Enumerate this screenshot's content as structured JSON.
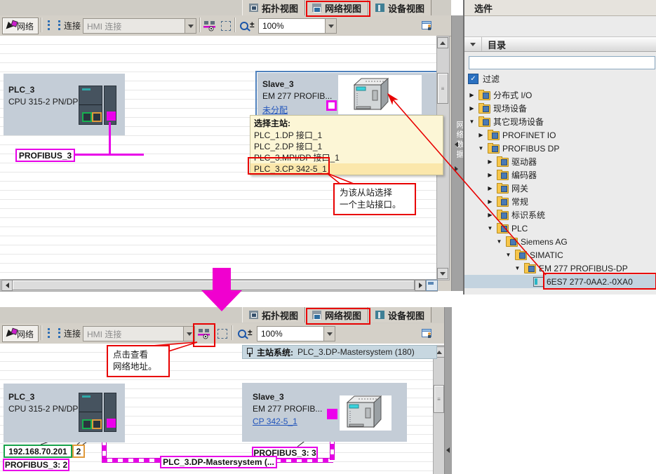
{
  "view_tabs": [
    {
      "label": "拓扑视图"
    },
    {
      "label": "网络视图",
      "highlighted": true
    },
    {
      "label": "设备视图"
    }
  ],
  "options_panel": {
    "title": "选件"
  },
  "toolbar": {
    "network_btn": "网络",
    "connections_btn": "连接",
    "connection_type": "HMI 连接",
    "zoom_value": "100%"
  },
  "network_data_tab": "网络数据",
  "catalog": {
    "title": "目录",
    "search_value": "",
    "filter_label": "过滤",
    "tree": [
      {
        "label": "分布式 I/O",
        "depth": 0,
        "state": "collapsed",
        "icon": "folder"
      },
      {
        "label": "现场设备",
        "depth": 0,
        "state": "collapsed",
        "icon": "folder"
      },
      {
        "label": "其它现场设备",
        "depth": 0,
        "state": "expanded",
        "icon": "folder"
      },
      {
        "label": "PROFINET IO",
        "depth": 1,
        "state": "collapsed",
        "icon": "folder"
      },
      {
        "label": "PROFIBUS DP",
        "depth": 1,
        "state": "expanded",
        "icon": "folder"
      },
      {
        "label": "驱动器",
        "depth": 2,
        "state": "collapsed",
        "icon": "folder"
      },
      {
        "label": "编码器",
        "depth": 2,
        "state": "collapsed",
        "icon": "folder"
      },
      {
        "label": "网关",
        "depth": 2,
        "state": "collapsed",
        "icon": "folder"
      },
      {
        "label": "常规",
        "depth": 2,
        "state": "collapsed",
        "icon": "folder"
      },
      {
        "label": "标识系统",
        "depth": 2,
        "state": "collapsed",
        "icon": "folder"
      },
      {
        "label": "PLC",
        "depth": 2,
        "state": "expanded",
        "icon": "folder"
      },
      {
        "label": "Siemens AG",
        "depth": 3,
        "state": "expanded",
        "icon": "folder"
      },
      {
        "label": "SIMATIC",
        "depth": 4,
        "state": "expanded",
        "icon": "folder"
      },
      {
        "label": "EM 277 PROFIBUS-DP",
        "depth": 5,
        "state": "expanded",
        "icon": "folder"
      },
      {
        "label": "6ES7 277-0AA2.-0XA0",
        "depth": 6,
        "state": "leaf",
        "icon": "module",
        "selected": true
      }
    ]
  },
  "top_view": {
    "plc": {
      "name": "PLC_3",
      "type": "CPU 315-2 PN/DP"
    },
    "slave": {
      "name": "Slave_3",
      "type": "EM 277  PROFIB...",
      "link": "未分配"
    },
    "profibus_label": "PROFIBUS_3",
    "master_select": {
      "title": "选择主站:",
      "options": [
        "PLC_1.DP 接口_1",
        "PLC_2.DP 接口_1",
        "PLC_3.MPI/DP 接口_1",
        "PLC_3.CP 342-5_1"
      ],
      "highlighted_index": 3
    },
    "callout": [
      "为该从站选择",
      "一个主站接口。"
    ]
  },
  "bottom_view": {
    "master_bar": {
      "prefix": "主站系统:",
      "value": "PLC_3.DP-Mastersystem (180)"
    },
    "plc": {
      "name": "PLC_3",
      "type": "CPU 315-2 PN/DP",
      "ip_label": "192.168.70.201",
      "dp_addr": "2",
      "profibus_label": "PROFIBUS_3:  2"
    },
    "slave": {
      "name": "Slave_3",
      "type": "EM 277  PROFIB...",
      "link": "CP 342-5_1",
      "profibus_label": "PROFIBUS_3:  3"
    },
    "mastersystem_label": "PLC_3.DP-Mastersystem (...",
    "callout": [
      "点击查看",
      "网络地址。"
    ]
  },
  "colors": {
    "profibus_magenta": "#e800e8",
    "annotation_red": "#e80000",
    "selection_blue": "#4f81bd",
    "ethernet_green": "#17a24a",
    "dp_orange": "#e09a3c",
    "big_arrow_pink": "#f000cf"
  }
}
